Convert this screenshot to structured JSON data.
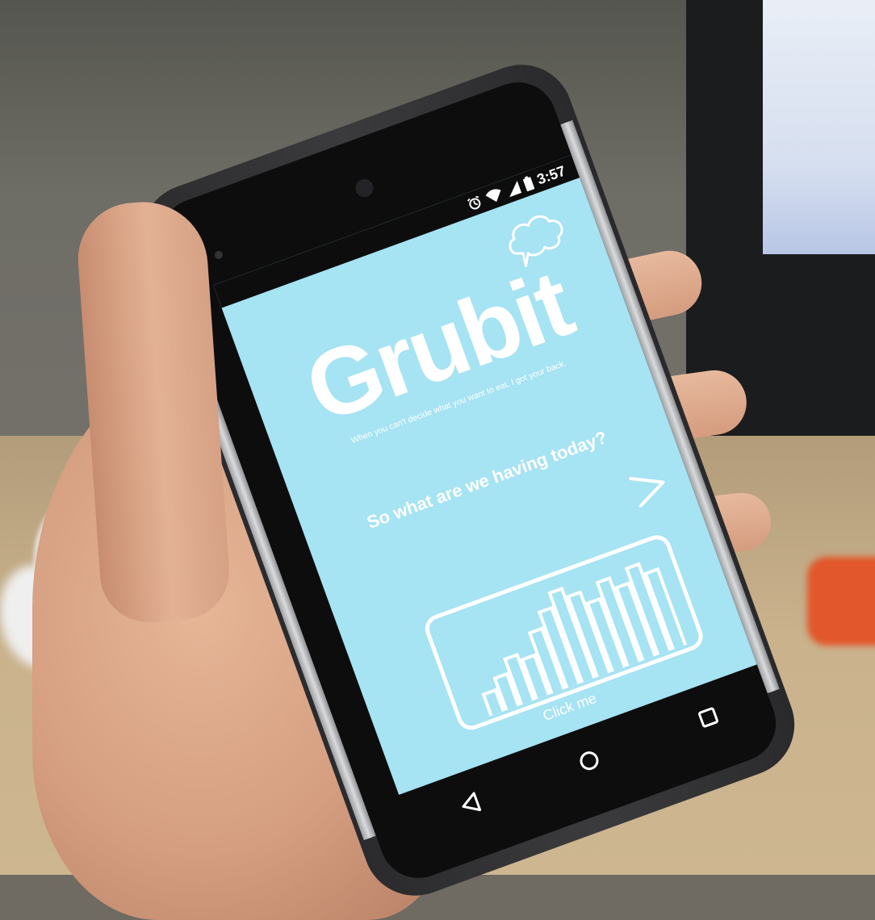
{
  "status_bar": {
    "time": "3:57",
    "icons": [
      "alarm-icon",
      "wifi-icon",
      "signal-icon",
      "battery-icon"
    ]
  },
  "app": {
    "logo": "Grubit",
    "tagline": "When you can't decide what you want to eat, I got your back.",
    "question": "So what are we having today?",
    "next_icon": "chevron-right-icon",
    "decor_icon": "thought-bubble-icon",
    "button_icon": "bar-chart-icon",
    "button_label": "Click me"
  },
  "nav": {
    "back_icon": "triangle-back-icon",
    "home_icon": "circle-home-icon",
    "recents_icon": "square-recents-icon"
  },
  "colors": {
    "screen_bg": "#a6e3f3",
    "text": "#ffffff"
  }
}
